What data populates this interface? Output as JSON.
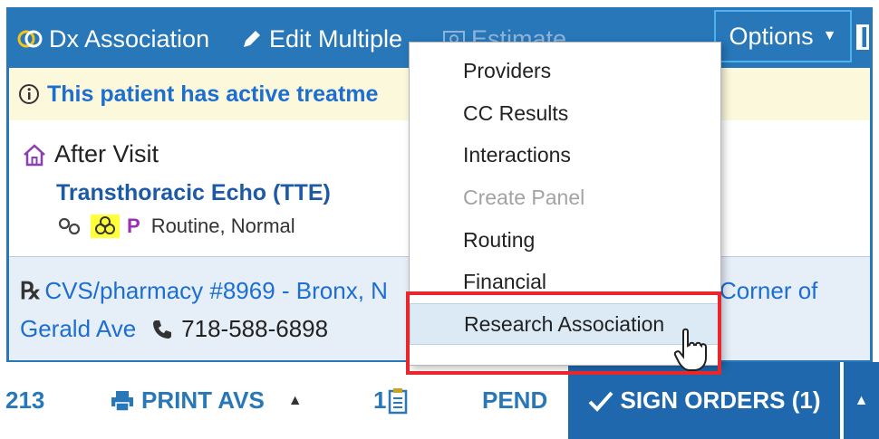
{
  "toolbar": {
    "dx_association": "Dx Association",
    "edit_multiple": "Edit Multiple",
    "estimate": "Estimate",
    "options": "Options"
  },
  "banner": {
    "text": "This patient has active treatme"
  },
  "visit": {
    "title": "After Visit",
    "order_name": "Transthoracic Echo (TTE)",
    "priority_letter": "P",
    "status": "Routine, Normal"
  },
  "pharmacy": {
    "name": "CVS/pharmacy #8969 - Bronx, N",
    "address_tail": "Corner of",
    "address_line2": "Gerald Ave",
    "phone": "718-588-6898"
  },
  "footer": {
    "left_number": "213",
    "print_avs": "PRINT AVS",
    "count": "1",
    "pend": "PEND",
    "sign_orders": "SIGN ORDERS (1)"
  },
  "options_menu": {
    "items": [
      {
        "label": "Providers",
        "enabled": true
      },
      {
        "label": "CC Results",
        "enabled": true
      },
      {
        "label": "Interactions",
        "enabled": true
      },
      {
        "label": "Create Panel",
        "enabled": false
      },
      {
        "label": "Routing",
        "enabled": true
      },
      {
        "label": "Financial",
        "enabled": true
      },
      {
        "label": "Research Association",
        "enabled": true,
        "hovered": true
      }
    ]
  },
  "colors": {
    "toolbar_blue": "#2777b9",
    "link_blue": "#1c6ed0",
    "banner_bg": "#fbf8dc",
    "highlight_red": "#e8262c",
    "sign_button_blue": "#1f68ad"
  }
}
